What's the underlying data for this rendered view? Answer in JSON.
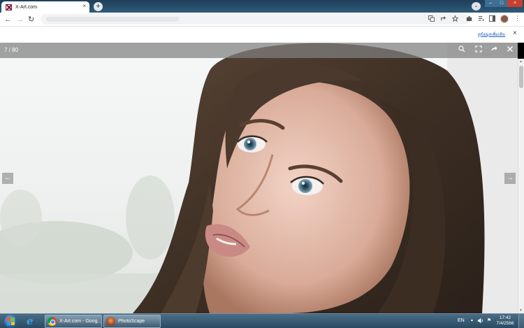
{
  "browser": {
    "tab_title": "X-Art.com",
    "tab_close": "×",
    "new_tab": "+",
    "tab_search": "⌄",
    "window_controls": {
      "minimize": "–",
      "maximize": "□",
      "close": "×"
    },
    "nav": {
      "back": "←",
      "forward": "→",
      "reload": "↻"
    },
    "toolbar_icons": [
      "translate-icon",
      "share-icon",
      "bookmark-star-icon",
      "extensions-icon",
      "reading-list-icon",
      "side-panel-icon"
    ]
  },
  "page_strip": {
    "more_info_link": "ดูข้อมูลเพิ่มเติม",
    "close": "×"
  },
  "viewer": {
    "counter": "7 / 80",
    "zoom": "⌕",
    "fullscreen": "⛶",
    "share": "➦",
    "close": "✕",
    "prev": "←",
    "next": "→"
  },
  "taskbar": {
    "tasks": [
      {
        "label": "X-Art.com - Goog...",
        "icon": "chrome-icon"
      },
      {
        "label": "PhotoScape",
        "icon": "photoscape-icon"
      }
    ],
    "tray": {
      "language": "EN",
      "up_arrow": "▲",
      "volume": "🔈",
      "flag": "⚑"
    },
    "clock": {
      "time": "17:42",
      "date": "7/4/2566"
    }
  }
}
